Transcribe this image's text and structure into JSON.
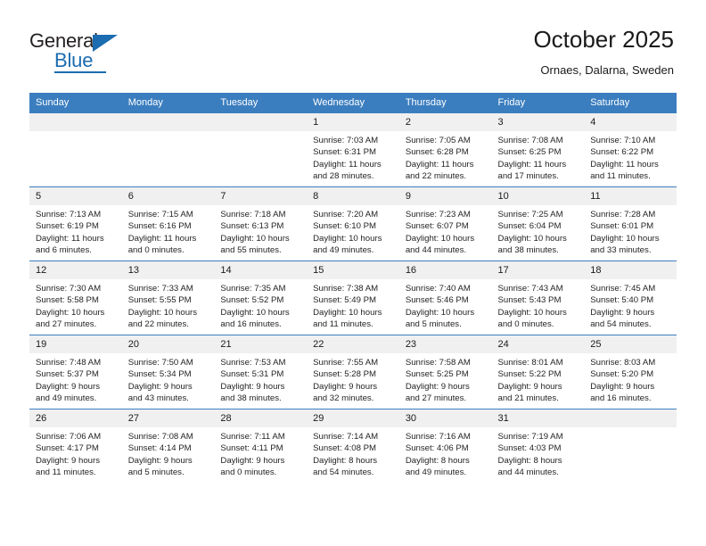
{
  "brand": {
    "name_top": "General",
    "name_bottom": "Blue",
    "accent_color": "#1b6cb0"
  },
  "header": {
    "title": "October 2025",
    "subtitle": "Ornaes, Dalarna, Sweden"
  },
  "theme": {
    "header_row_bg": "#3b7ebf",
    "daynum_bg": "#f0f0f0",
    "text_color": "#1a1a1a"
  },
  "weekdays": [
    "Sunday",
    "Monday",
    "Tuesday",
    "Wednesday",
    "Thursday",
    "Friday",
    "Saturday"
  ],
  "weeks": [
    [
      {
        "day": "",
        "sunrise": "",
        "sunset": "",
        "daylight_line1": "",
        "daylight_line2": ""
      },
      {
        "day": "",
        "sunrise": "",
        "sunset": "",
        "daylight_line1": "",
        "daylight_line2": ""
      },
      {
        "day": "",
        "sunrise": "",
        "sunset": "",
        "daylight_line1": "",
        "daylight_line2": ""
      },
      {
        "day": "1",
        "sunrise": "Sunrise: 7:03 AM",
        "sunset": "Sunset: 6:31 PM",
        "daylight_line1": "Daylight: 11 hours",
        "daylight_line2": "and 28 minutes."
      },
      {
        "day": "2",
        "sunrise": "Sunrise: 7:05 AM",
        "sunset": "Sunset: 6:28 PM",
        "daylight_line1": "Daylight: 11 hours",
        "daylight_line2": "and 22 minutes."
      },
      {
        "day": "3",
        "sunrise": "Sunrise: 7:08 AM",
        "sunset": "Sunset: 6:25 PM",
        "daylight_line1": "Daylight: 11 hours",
        "daylight_line2": "and 17 minutes."
      },
      {
        "day": "4",
        "sunrise": "Sunrise: 7:10 AM",
        "sunset": "Sunset: 6:22 PM",
        "daylight_line1": "Daylight: 11 hours",
        "daylight_line2": "and 11 minutes."
      }
    ],
    [
      {
        "day": "5",
        "sunrise": "Sunrise: 7:13 AM",
        "sunset": "Sunset: 6:19 PM",
        "daylight_line1": "Daylight: 11 hours",
        "daylight_line2": "and 6 minutes."
      },
      {
        "day": "6",
        "sunrise": "Sunrise: 7:15 AM",
        "sunset": "Sunset: 6:16 PM",
        "daylight_line1": "Daylight: 11 hours",
        "daylight_line2": "and 0 minutes."
      },
      {
        "day": "7",
        "sunrise": "Sunrise: 7:18 AM",
        "sunset": "Sunset: 6:13 PM",
        "daylight_line1": "Daylight: 10 hours",
        "daylight_line2": "and 55 minutes."
      },
      {
        "day": "8",
        "sunrise": "Sunrise: 7:20 AM",
        "sunset": "Sunset: 6:10 PM",
        "daylight_line1": "Daylight: 10 hours",
        "daylight_line2": "and 49 minutes."
      },
      {
        "day": "9",
        "sunrise": "Sunrise: 7:23 AM",
        "sunset": "Sunset: 6:07 PM",
        "daylight_line1": "Daylight: 10 hours",
        "daylight_line2": "and 44 minutes."
      },
      {
        "day": "10",
        "sunrise": "Sunrise: 7:25 AM",
        "sunset": "Sunset: 6:04 PM",
        "daylight_line1": "Daylight: 10 hours",
        "daylight_line2": "and 38 minutes."
      },
      {
        "day": "11",
        "sunrise": "Sunrise: 7:28 AM",
        "sunset": "Sunset: 6:01 PM",
        "daylight_line1": "Daylight: 10 hours",
        "daylight_line2": "and 33 minutes."
      }
    ],
    [
      {
        "day": "12",
        "sunrise": "Sunrise: 7:30 AM",
        "sunset": "Sunset: 5:58 PM",
        "daylight_line1": "Daylight: 10 hours",
        "daylight_line2": "and 27 minutes."
      },
      {
        "day": "13",
        "sunrise": "Sunrise: 7:33 AM",
        "sunset": "Sunset: 5:55 PM",
        "daylight_line1": "Daylight: 10 hours",
        "daylight_line2": "and 22 minutes."
      },
      {
        "day": "14",
        "sunrise": "Sunrise: 7:35 AM",
        "sunset": "Sunset: 5:52 PM",
        "daylight_line1": "Daylight: 10 hours",
        "daylight_line2": "and 16 minutes."
      },
      {
        "day": "15",
        "sunrise": "Sunrise: 7:38 AM",
        "sunset": "Sunset: 5:49 PM",
        "daylight_line1": "Daylight: 10 hours",
        "daylight_line2": "and 11 minutes."
      },
      {
        "day": "16",
        "sunrise": "Sunrise: 7:40 AM",
        "sunset": "Sunset: 5:46 PM",
        "daylight_line1": "Daylight: 10 hours",
        "daylight_line2": "and 5 minutes."
      },
      {
        "day": "17",
        "sunrise": "Sunrise: 7:43 AM",
        "sunset": "Sunset: 5:43 PM",
        "daylight_line1": "Daylight: 10 hours",
        "daylight_line2": "and 0 minutes."
      },
      {
        "day": "18",
        "sunrise": "Sunrise: 7:45 AM",
        "sunset": "Sunset: 5:40 PM",
        "daylight_line1": "Daylight: 9 hours",
        "daylight_line2": "and 54 minutes."
      }
    ],
    [
      {
        "day": "19",
        "sunrise": "Sunrise: 7:48 AM",
        "sunset": "Sunset: 5:37 PM",
        "daylight_line1": "Daylight: 9 hours",
        "daylight_line2": "and 49 minutes."
      },
      {
        "day": "20",
        "sunrise": "Sunrise: 7:50 AM",
        "sunset": "Sunset: 5:34 PM",
        "daylight_line1": "Daylight: 9 hours",
        "daylight_line2": "and 43 minutes."
      },
      {
        "day": "21",
        "sunrise": "Sunrise: 7:53 AM",
        "sunset": "Sunset: 5:31 PM",
        "daylight_line1": "Daylight: 9 hours",
        "daylight_line2": "and 38 minutes."
      },
      {
        "day": "22",
        "sunrise": "Sunrise: 7:55 AM",
        "sunset": "Sunset: 5:28 PM",
        "daylight_line1": "Daylight: 9 hours",
        "daylight_line2": "and 32 minutes."
      },
      {
        "day": "23",
        "sunrise": "Sunrise: 7:58 AM",
        "sunset": "Sunset: 5:25 PM",
        "daylight_line1": "Daylight: 9 hours",
        "daylight_line2": "and 27 minutes."
      },
      {
        "day": "24",
        "sunrise": "Sunrise: 8:01 AM",
        "sunset": "Sunset: 5:22 PM",
        "daylight_line1": "Daylight: 9 hours",
        "daylight_line2": "and 21 minutes."
      },
      {
        "day": "25",
        "sunrise": "Sunrise: 8:03 AM",
        "sunset": "Sunset: 5:20 PM",
        "daylight_line1": "Daylight: 9 hours",
        "daylight_line2": "and 16 minutes."
      }
    ],
    [
      {
        "day": "26",
        "sunrise": "Sunrise: 7:06 AM",
        "sunset": "Sunset: 4:17 PM",
        "daylight_line1": "Daylight: 9 hours",
        "daylight_line2": "and 11 minutes."
      },
      {
        "day": "27",
        "sunrise": "Sunrise: 7:08 AM",
        "sunset": "Sunset: 4:14 PM",
        "daylight_line1": "Daylight: 9 hours",
        "daylight_line2": "and 5 minutes."
      },
      {
        "day": "28",
        "sunrise": "Sunrise: 7:11 AM",
        "sunset": "Sunset: 4:11 PM",
        "daylight_line1": "Daylight: 9 hours",
        "daylight_line2": "and 0 minutes."
      },
      {
        "day": "29",
        "sunrise": "Sunrise: 7:14 AM",
        "sunset": "Sunset: 4:08 PM",
        "daylight_line1": "Daylight: 8 hours",
        "daylight_line2": "and 54 minutes."
      },
      {
        "day": "30",
        "sunrise": "Sunrise: 7:16 AM",
        "sunset": "Sunset: 4:06 PM",
        "daylight_line1": "Daylight: 8 hours",
        "daylight_line2": "and 49 minutes."
      },
      {
        "day": "31",
        "sunrise": "Sunrise: 7:19 AM",
        "sunset": "Sunset: 4:03 PM",
        "daylight_line1": "Daylight: 8 hours",
        "daylight_line2": "and 44 minutes."
      },
      {
        "day": "",
        "sunrise": "",
        "sunset": "",
        "daylight_line1": "",
        "daylight_line2": ""
      }
    ]
  ]
}
